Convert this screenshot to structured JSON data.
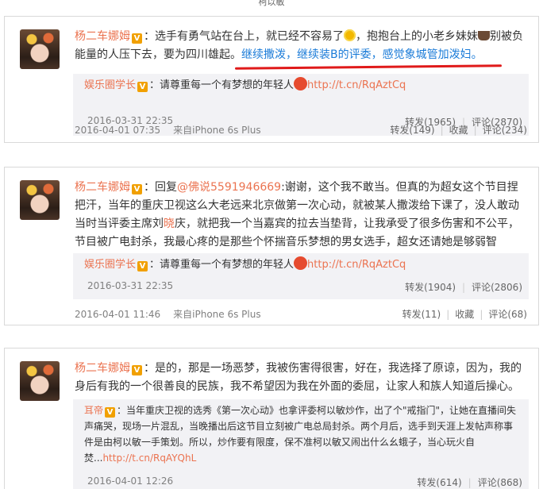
{
  "top_fragment": "柯以敏",
  "posts": [
    {
      "author": "杨二车娜姆",
      "v": "V",
      "segments": {
        "a": "：选手有勇气站在台上，就已经不容易了",
        "b": "，抱抱台上的小老乡妹妹",
        "c": "别被负能量的人压下去，要为四川雄起。",
        "hl": "继续撒泼，继续装B的评委，感觉象城管加泼妇。"
      },
      "repost": {
        "author": "娱乐圈学长",
        "v": "V",
        "text": "：请尊重每一个有梦想的年轻人",
        "link": "http://t.cn/RqAztCq",
        "date": "2016-03-31 22:35",
        "repost_label": "转发(1965)",
        "comment_label": "评论(2870)"
      },
      "date": "2016-04-01 07:35",
      "source": "来自iPhone 6s Plus",
      "repost_label": "转发(149)",
      "fav_label": "收藏",
      "comment_label": "评论(234)"
    },
    {
      "author": "杨二车娜姆",
      "v": "V",
      "segments": {
        "a": "：回复",
        "mention": "@佛说5591946669",
        "b": ":谢谢，这个我不敢当。但真的为超女这个节目捏把汗，当年的重庆卫视这么大老远来北京做第一次心动，就被某人撒泼给下课了，没人敢动当时当评委主席刘",
        "c": "晓",
        "d": "庆，就把我一个当嘉宾的拉去当垫背，让我承受了很多伤害和不公平，节目被广电封杀，我最心疼的是那些个怀揣音乐梦想的男女选手，超女还请她是够弱智"
      },
      "repost": {
        "author": "娱乐圈学长",
        "v": "V",
        "text": "：请尊重每一个有梦想的年轻人",
        "link": "http://t.cn/RqAztCq",
        "date": "2016-03-31 22:35",
        "repost_label": "转发(1904)",
        "comment_label": "评论(2806)"
      },
      "date": "2016-04-01 11:46",
      "source": "来自iPhone 6s Plus",
      "repost_label": "转发(11)",
      "fav_label": "收藏",
      "comment_label": "评论(68)"
    },
    {
      "author": "杨二车娜姆",
      "v": "V",
      "segments": {
        "a": "：是的，那是一场恶梦，我被伤害得很害，好在，我选择了原谅，因为，我的身后有我的一个很善良的民族，我不希望因为我在外面的委屈，让家人和族人知道后操心。"
      },
      "repost": {
        "author": "耳帝",
        "v": "V",
        "text": "：当年重庆卫视的选秀《第一次心动》也拿评委柯以敏炒作，出了个\"戒指门\"，让她在直播间失声痛哭，现场一片混乱，当晚播出后这节目立刻被广电总局封杀。两个月后，选手到天涯上发帖声称事件是由柯以敏一手策划。所以，炒作要有限度，保不准柯以敏又闹出什么幺蛾子，当心玩火自焚...",
        "link": "http://t.cn/RqAYQhL",
        "date": "2016-04-01 12:26",
        "repost_label": "转发(614)",
        "comment_label": "评论(868)"
      }
    }
  ]
}
